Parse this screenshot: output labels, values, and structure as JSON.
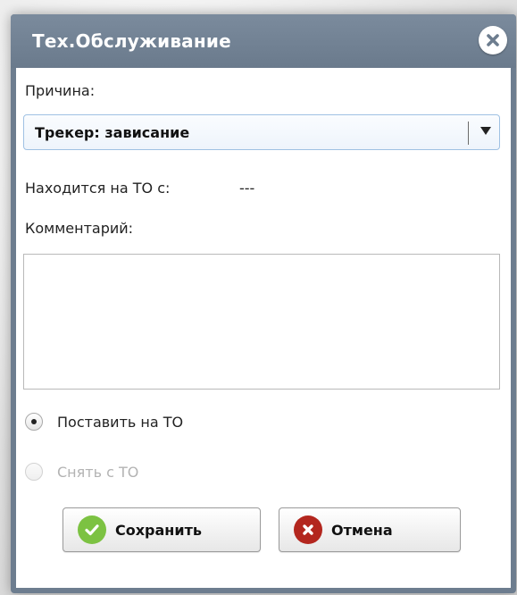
{
  "dialog": {
    "title": "Тех.Обслуживание",
    "close_icon": "close-icon"
  },
  "form": {
    "reason_label": "Причина:",
    "reason_value": "Трекер: зависание",
    "since_label": "Находится на ТО с:",
    "since_value": "---",
    "comment_label": "Комментарий:",
    "comment_value": ""
  },
  "options": [
    {
      "label": "Поставить на ТО",
      "selected": true,
      "enabled": true
    },
    {
      "label": "Снять с ТО",
      "selected": false,
      "enabled": false
    }
  ],
  "buttons": {
    "save_label": "Сохранить",
    "save_icon": "check-icon",
    "cancel_label": "Отмена",
    "cancel_icon": "x-circle-icon"
  },
  "colors": {
    "title_bar": "#6d7d8f",
    "save_icon": "#7cc242",
    "cancel_icon": "#b3261e",
    "select_border": "#9fc1e3"
  }
}
